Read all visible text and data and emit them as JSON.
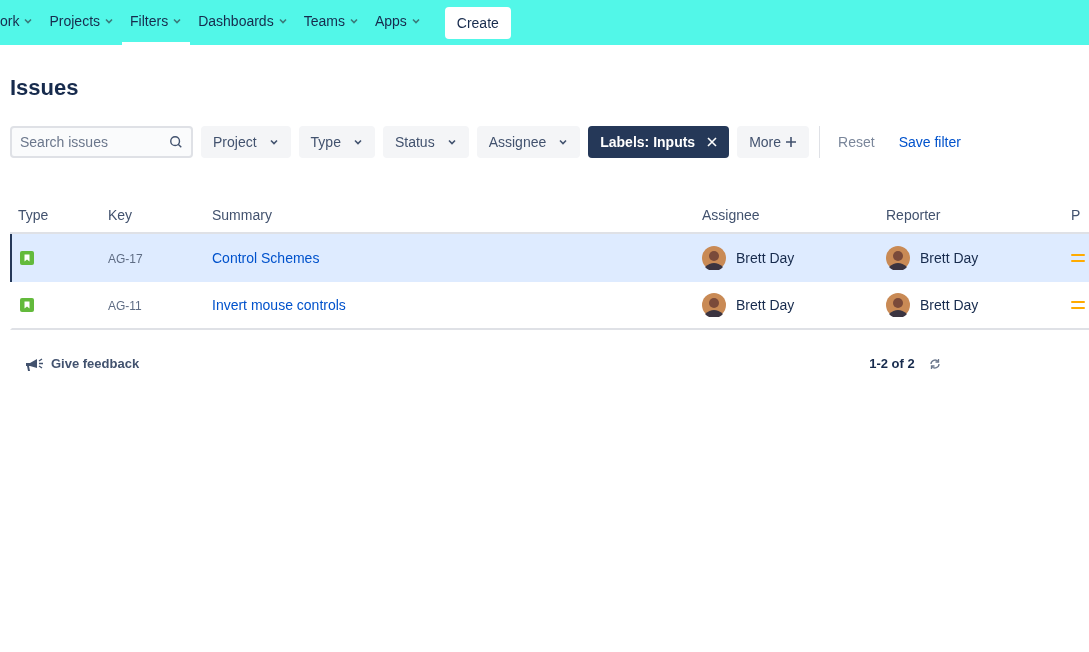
{
  "nav": {
    "items": [
      {
        "label": "ork",
        "selected": false
      },
      {
        "label": "Projects",
        "selected": false
      },
      {
        "label": "Filters",
        "selected": true
      },
      {
        "label": "Dashboards",
        "selected": false
      },
      {
        "label": "Teams",
        "selected": false
      },
      {
        "label": "Apps",
        "selected": false
      }
    ],
    "create": "Create"
  },
  "title": "Issues",
  "search": {
    "placeholder": "Search issues"
  },
  "filters": [
    {
      "kind": "dropdown",
      "label": "Project"
    },
    {
      "kind": "dropdown",
      "label": "Type"
    },
    {
      "kind": "dropdown",
      "label": "Status"
    },
    {
      "kind": "dropdown",
      "label": "Assignee"
    },
    {
      "kind": "applied",
      "label": "Labels: Inputs"
    },
    {
      "kind": "more",
      "label": "More"
    }
  ],
  "actions": [
    {
      "kind": "muted",
      "label": "Reset"
    },
    {
      "kind": "link",
      "label": "Save filter"
    }
  ],
  "table": {
    "columns": [
      "Type",
      "Key",
      "Summary",
      "Assignee",
      "Reporter",
      "P"
    ],
    "rows": [
      {
        "selected": true,
        "type_icon": {
          "kind": "story"
        },
        "key": "AG-17",
        "summary": "Control Schemes",
        "assignee": "Brett Day",
        "reporter": "Brett Day",
        "priority_icon": {
          "kind": "medium"
        }
      },
      {
        "selected": false,
        "type_icon": {
          "kind": "story"
        },
        "key": "AG-11",
        "summary": "Invert mouse controls",
        "assignee": "Brett Day",
        "reporter": "Brett Day",
        "priority_icon": {
          "kind": "medium"
        }
      }
    ]
  },
  "footer": {
    "feedback": "Give feedback",
    "count": "1-2 of 2"
  }
}
